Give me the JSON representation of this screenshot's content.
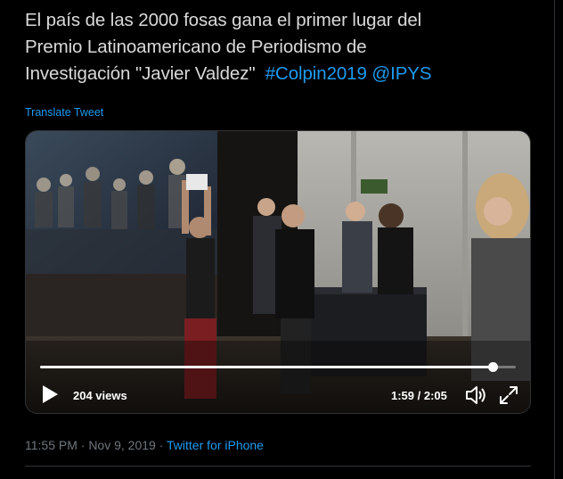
{
  "tweet": {
    "line1": "El país de las 2000 fosas gana el primer lugar del",
    "line2": "Premio Latinoamericano de Periodismo de",
    "line3_text": "Investigación \"Javier Valdez\"",
    "hashtag": "#Colpin2019",
    "mention": "@IPYS",
    "translate_label": "Translate Tweet"
  },
  "video": {
    "views": "204 views",
    "time": "1:59 / 2:05",
    "progress": 0.952,
    "play_icon": "play-icon",
    "volume_icon": "volume-icon",
    "fullscreen_icon": "fullscreen-icon"
  },
  "meta": {
    "timestamp": "11:55 PM · Nov 9, 2019",
    "separator": " · ",
    "source": "Twitter for iPhone"
  },
  "colors": {
    "background": "#000000",
    "text": "#d9d9d9",
    "link": "#1d9bf0",
    "muted": "#6e767d",
    "border": "#2f3336"
  }
}
